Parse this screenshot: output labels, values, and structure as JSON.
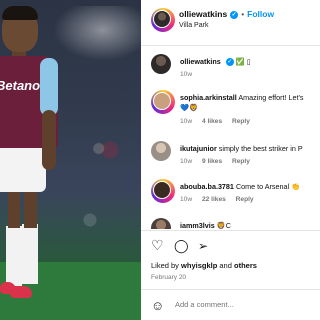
{
  "header": {
    "username": "olliewatkins",
    "verified_icon": "verified-badge-icon",
    "separator": "•",
    "follow_label": "Follow",
    "location": "Villa Park"
  },
  "photo": {
    "sponsor_text": "Betano",
    "description_icon": "player-photo"
  },
  "comments": [
    {
      "user": "olliewatkins",
      "text": "✅ ▯",
      "meta": [
        "10w"
      ]
    },
    {
      "user": "sophia.arkinstall",
      "text": "Amazing effort! Let's",
      "line2": "💙🦁",
      "meta": [
        "10w",
        "4 likes",
        "Reply"
      ]
    },
    {
      "user": "ikutajunior",
      "text": "simply the best striker in P",
      "meta": [
        "10w",
        "9 likes",
        "Reply"
      ]
    },
    {
      "user": "abouba.ba.3781",
      "text": "Come to Arsenal 👏",
      "meta": [
        "10w",
        "22 likes",
        "Reply"
      ]
    },
    {
      "user": "iamm3lvis",
      "text": "🦁C",
      "meta": []
    }
  ],
  "actions": {
    "liked_prefix": "Liked by ",
    "liked_user": "whyisgklp",
    "liked_and": " and ",
    "liked_others": "others",
    "date": "February 20"
  },
  "add_comment": {
    "placeholder": "Add a comment..."
  },
  "colors": {
    "accent": "#0095f6",
    "shirt": "#6b1f3a"
  }
}
